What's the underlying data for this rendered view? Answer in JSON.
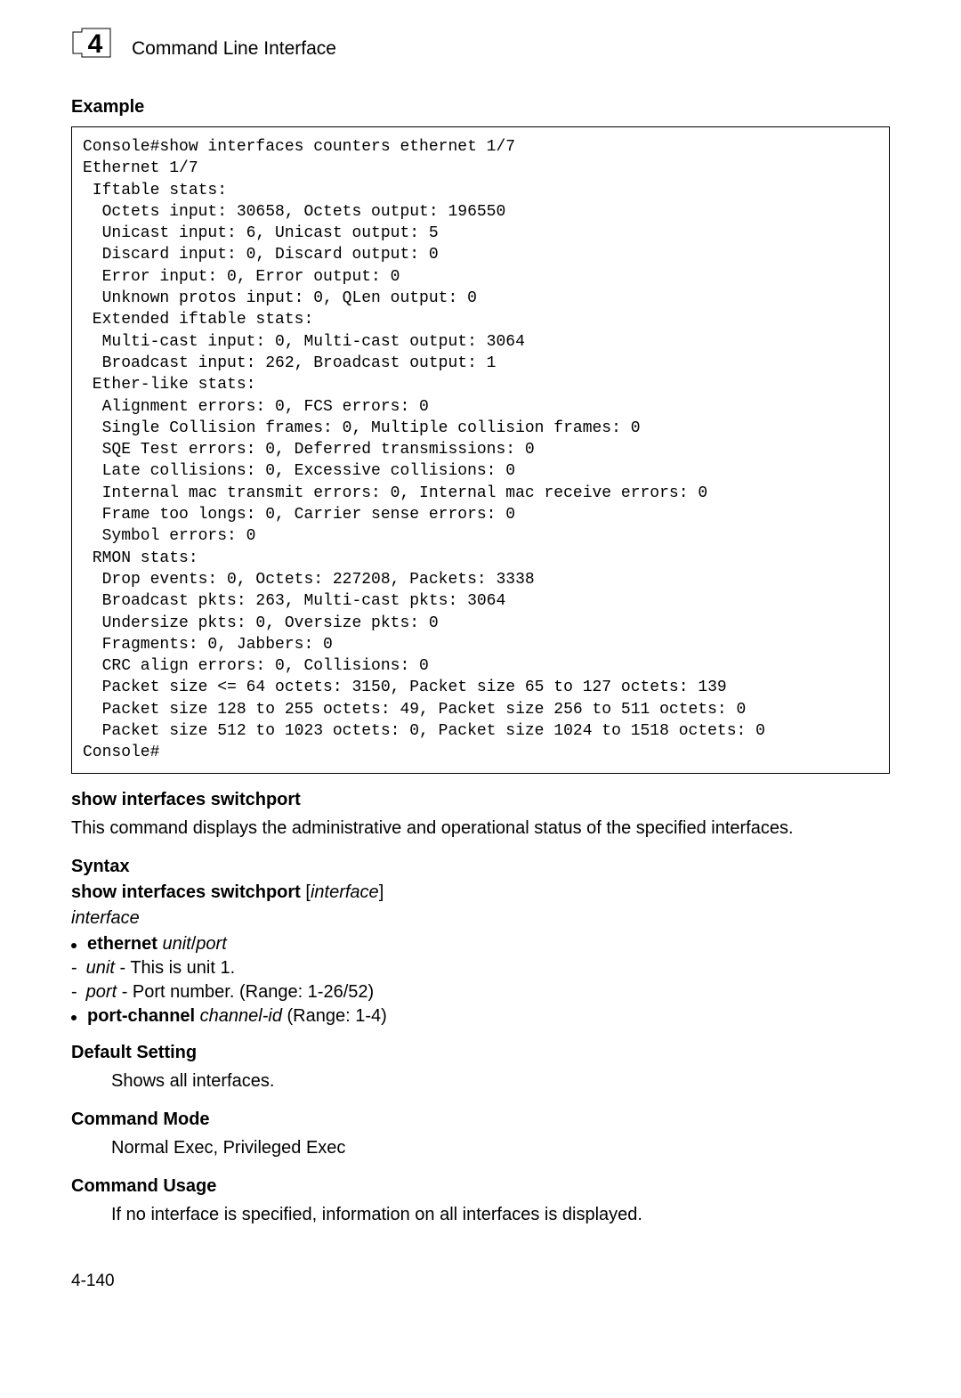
{
  "header": {
    "chapter_number": "4",
    "title": "Command Line Interface"
  },
  "example": {
    "heading": "Example",
    "code": "Console#show interfaces counters ethernet 1/7\nEthernet 1/7\n Iftable stats:\n  Octets input: 30658, Octets output: 196550\n  Unicast input: 6, Unicast output: 5\n  Discard input: 0, Discard output: 0\n  Error input: 0, Error output: 0\n  Unknown protos input: 0, QLen output: 0\n Extended iftable stats:\n  Multi-cast input: 0, Multi-cast output: 3064\n  Broadcast input: 262, Broadcast output: 1\n Ether-like stats:\n  Alignment errors: 0, FCS errors: 0\n  Single Collision frames: 0, Multiple collision frames: 0\n  SQE Test errors: 0, Deferred transmissions: 0\n  Late collisions: 0, Excessive collisions: 0\n  Internal mac transmit errors: 0, Internal mac receive errors: 0\n  Frame too longs: 0, Carrier sense errors: 0\n  Symbol errors: 0\n RMON stats:\n  Drop events: 0, Octets: 227208, Packets: 3338\n  Broadcast pkts: 263, Multi-cast pkts: 3064\n  Undersize pkts: 0, Oversize pkts: 0\n  Fragments: 0, Jabbers: 0\n  CRC align errors: 0, Collisions: 0\n  Packet size <= 64 octets: 3150, Packet size 65 to 127 octets: 139\n  Packet size 128 to 255 octets: 49, Packet size 256 to 511 octets: 0\n  Packet size 512 to 1023 octets: 0, Packet size 1024 to 1518 octets: 0\nConsole#"
  },
  "command": {
    "name": "show interfaces switchport",
    "description": "This command displays the administrative and operational status of the specified interfaces."
  },
  "syntax": {
    "heading": "Syntax",
    "command_bold": "show interfaces switchport",
    "command_param_open": " [",
    "command_param": "interface",
    "command_param_close": "]",
    "interface_label": "interface",
    "ethernet_bold": "ethernet",
    "ethernet_param": " unit",
    "ethernet_slash": "/",
    "ethernet_port": "port",
    "unit_label": "unit",
    "unit_desc": " - This is unit 1.",
    "port_label": "port",
    "port_desc": " - Port number. (Range: 1-26/52)",
    "portchannel_bold": "port-channel",
    "portchannel_param": " channel-id",
    "portchannel_range": " (Range: 1-4)"
  },
  "default_setting": {
    "heading": "Default Setting",
    "text": "Shows all interfaces."
  },
  "command_mode": {
    "heading": "Command Mode",
    "text": "Normal Exec, Privileged Exec"
  },
  "command_usage": {
    "heading": "Command Usage",
    "text": "If no interface is specified, information on all interfaces is displayed."
  },
  "page_number": "4-140"
}
